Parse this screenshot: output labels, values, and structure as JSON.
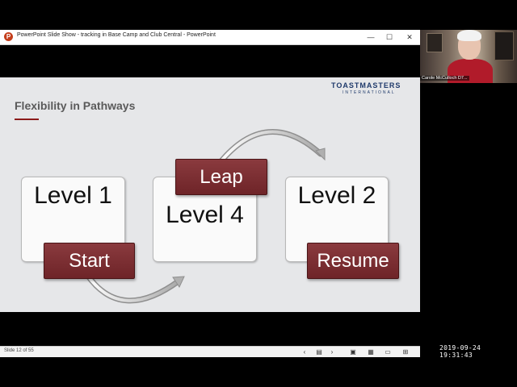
{
  "window": {
    "title": "PowerPoint Slide Show  -  tracking in Base Camp and Club Central - PowerPoint",
    "controls": {
      "minimize": "—",
      "maximize": "☐",
      "close": "✕"
    }
  },
  "slide": {
    "logo_main": "TOASTMASTERS",
    "logo_sub": "INTERNATIONAL",
    "title": "Flexibility in Pathways",
    "levels": {
      "level1": "Level 1",
      "level4": "Level 4",
      "level2": "Level 2"
    },
    "tags": {
      "start": "Start",
      "leap": "Leap",
      "resume": "Resume"
    },
    "colors": {
      "accent": "#7a2b2f",
      "background": "#e6e7e9"
    }
  },
  "statusbar": {
    "slide_counter": "Slide 12 of 55",
    "icons": [
      "prev-icon",
      "notes-icon",
      "next-icon",
      "normal-view-icon",
      "slide-sorter-icon",
      "reading-view-icon",
      "slideshow-icon"
    ]
  },
  "video": {
    "participant_name": "Carole McCulloch D7..."
  },
  "timestamp": "2019-09-24  19:31:43"
}
